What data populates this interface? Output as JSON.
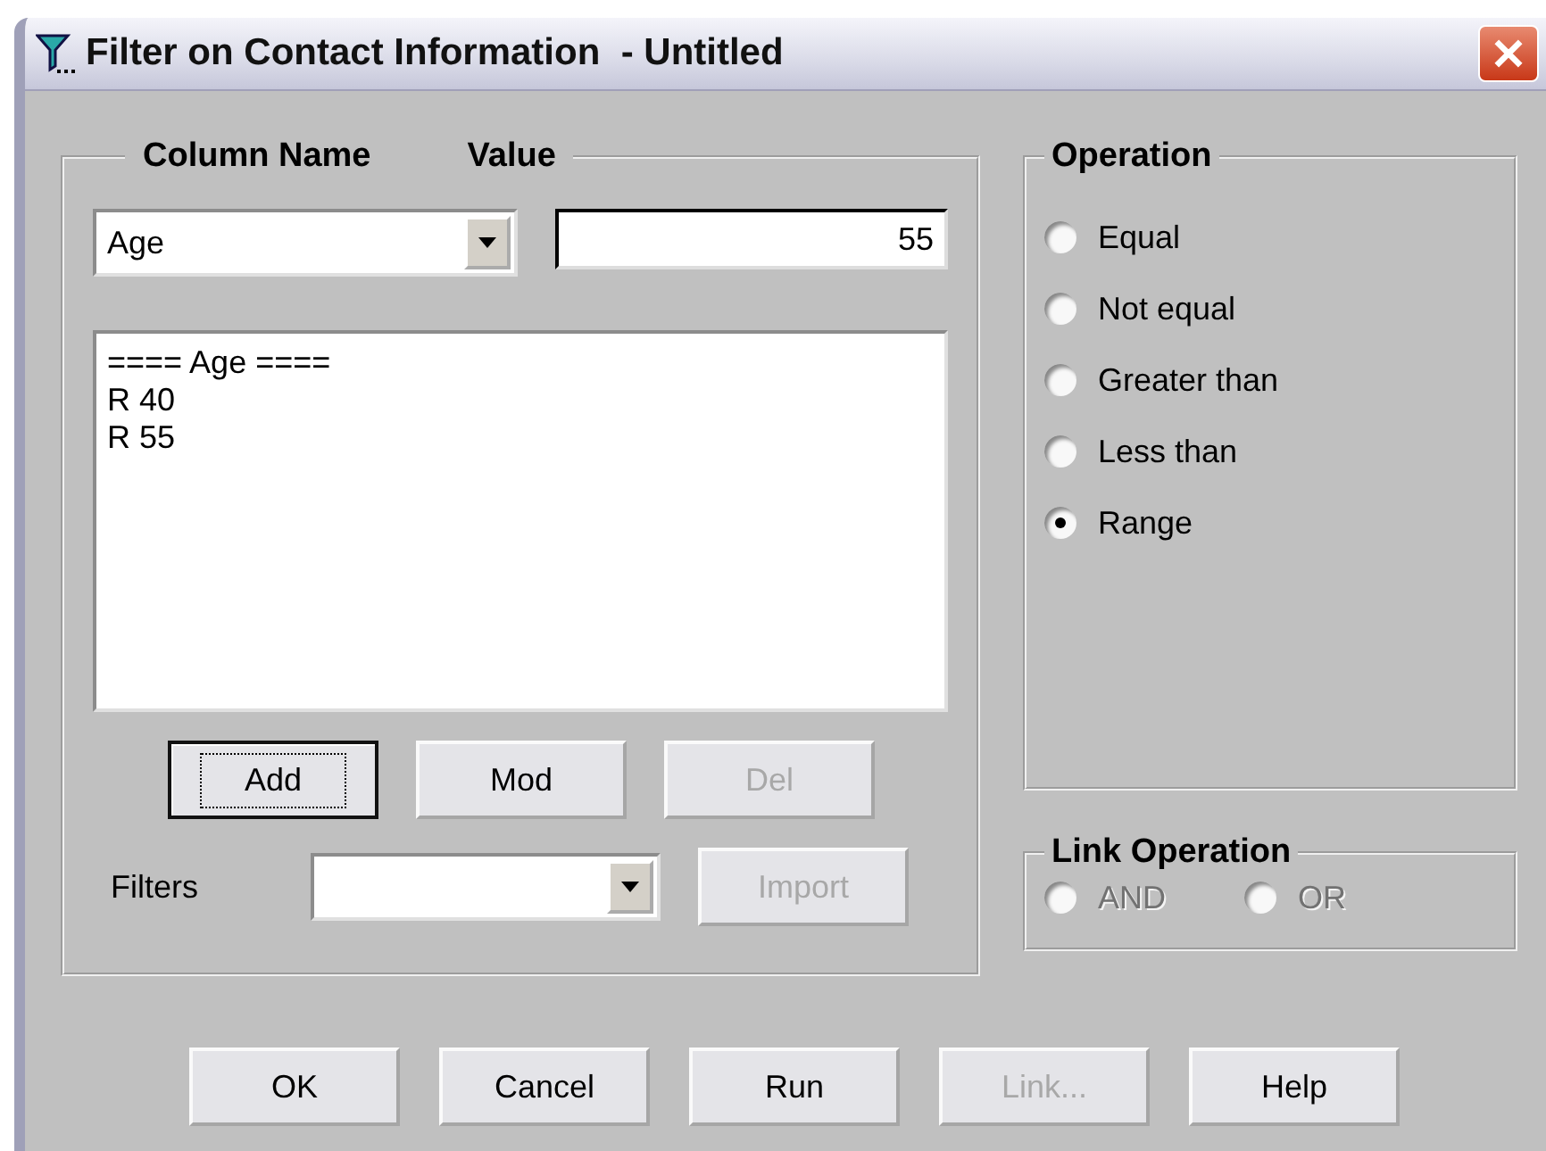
{
  "window": {
    "title": "Filter on Contact Information  - Untitled"
  },
  "criteria": {
    "column_label": "Column Name",
    "value_label": "Value",
    "column": {
      "value": "Age"
    },
    "value_field": {
      "value": "55"
    },
    "list": [
      "==== Age ====",
      "R 40",
      "R 55"
    ],
    "buttons": [
      {
        "label": "Add",
        "disabled": false,
        "focused": true
      },
      {
        "label": "Mod",
        "disabled": false,
        "focused": false
      },
      {
        "label": "Del",
        "disabled": true,
        "focused": false
      }
    ],
    "filters_label": "Filters",
    "import": {
      "label": "Import",
      "disabled": true
    }
  },
  "operation": {
    "title": "Operation",
    "options": [
      {
        "label": "Equal",
        "selected": false
      },
      {
        "label": "Not equal",
        "selected": false
      },
      {
        "label": "Greater than",
        "selected": false
      },
      {
        "label": "Less than",
        "selected": false
      },
      {
        "label": "Range",
        "selected": true
      }
    ]
  },
  "link_operation": {
    "title": "Link Operation",
    "options": [
      {
        "label": "AND",
        "selected": false,
        "disabled": true
      },
      {
        "label": "OR",
        "selected": false,
        "disabled": true
      }
    ]
  },
  "buttons": [
    {
      "label": "OK",
      "disabled": false
    },
    {
      "label": "Cancel",
      "disabled": false
    },
    {
      "label": "Run",
      "disabled": false
    },
    {
      "label": "Link...",
      "disabled": true
    },
    {
      "label": "Help",
      "disabled": false
    }
  ]
}
